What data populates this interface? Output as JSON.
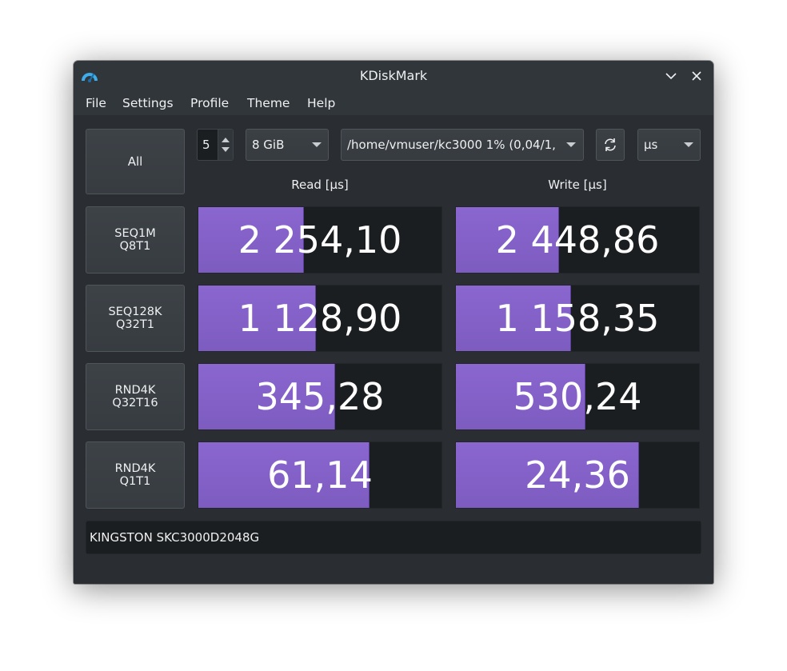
{
  "window": {
    "title": "KDiskMark"
  },
  "menu": [
    "File",
    "Settings",
    "Profile",
    "Theme",
    "Help"
  ],
  "toolbar": {
    "all_button": "All",
    "loops": "5",
    "size": "8 GiB",
    "path": "/home/vmuser/kc3000 1% (0,04/1,",
    "unit": "µs"
  },
  "headers": {
    "read": "Read [µs]",
    "write": "Write [µs]"
  },
  "rows": [
    {
      "label_line1": "SEQ1M",
      "label_line2": "Q8T1",
      "read": "2 254,10",
      "write": "2 448,86",
      "read_fill": 0.43,
      "write_fill": 0.42
    },
    {
      "label_line1": "SEQ128K",
      "label_line2": "Q32T1",
      "read": "1 128,90",
      "write": "1 158,35",
      "read_fill": 0.48,
      "write_fill": 0.47
    },
    {
      "label_line1": "RND4K",
      "label_line2": "Q32T16",
      "read": "345,28",
      "write": "530,24",
      "read_fill": 0.56,
      "write_fill": 0.53
    },
    {
      "label_line1": "RND4K",
      "label_line2": "Q1T1",
      "read": "61,14",
      "write": "24,36",
      "read_fill": 0.7,
      "write_fill": 0.75
    }
  ],
  "device": "KINGSTON SKC3000D2048G",
  "icons": {
    "app": "speedometer-icon",
    "minimize": "chevron-down-icon",
    "close": "close-icon",
    "refresh": "refresh-icon"
  },
  "colors": {
    "bar_fill": "#8a66cf",
    "background": "#2a2e32",
    "cell_background": "#1b1e20"
  }
}
